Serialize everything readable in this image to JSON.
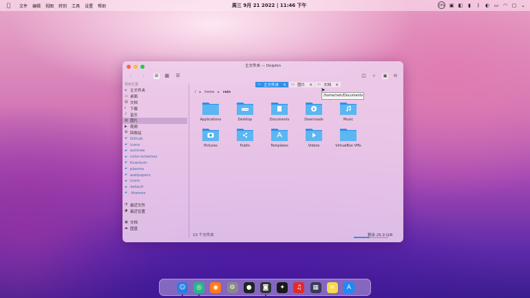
{
  "menubar": {
    "menus": [
      "文件",
      "编辑",
      "视图",
      "转到",
      "工具",
      "设置",
      "帮助"
    ],
    "clock": "周三 9月 21 2022 | 11:46 下午",
    "tray_percent": "19%",
    "tray_icons": [
      "cpu-icon",
      "monitor-icon",
      "package-icon",
      "battery-icon",
      "bluetooth-icon",
      "theme-icon",
      "battery-full-icon",
      "wifi-icon",
      "display-icon",
      "dropdown-icon"
    ]
  },
  "window": {
    "title": "主文件夹 — Dolphin",
    "colors": {
      "close": "#ff5f57",
      "minimize": "#febc2e",
      "maximize": "#28c840",
      "accent": "#2e8fe6"
    }
  },
  "sidebar": {
    "places_header": "常用位置",
    "places": [
      {
        "label": "主文件夹",
        "icon": "home-icon"
      },
      {
        "label": "桌面",
        "icon": "desktop-icon"
      },
      {
        "label": "文档",
        "icon": "document-icon"
      },
      {
        "label": "下载",
        "icon": "download-icon"
      },
      {
        "label": "音乐",
        "icon": "music-icon"
      },
      {
        "label": "图片",
        "icon": "picture-icon",
        "selected": true
      },
      {
        "label": "视频",
        "icon": "video-icon"
      },
      {
        "label": "回收站",
        "icon": "trash-icon"
      },
      {
        "label": "Github",
        "icon": "folder-icon"
      },
      {
        "label": "icons",
        "icon": "folder-icon"
      },
      {
        "label": "aurorae",
        "icon": "folder-icon"
      },
      {
        "label": "color-schemes",
        "icon": "folder-icon"
      },
      {
        "label": "Kvantum",
        "icon": "folder-icon"
      },
      {
        "label": "plasma",
        "icon": "folder-icon"
      },
      {
        "label": "wallpapers",
        "icon": "folder-icon"
      },
      {
        "label": "icons",
        "icon": "folder-icon"
      },
      {
        "label": "default",
        "icon": "folder-icon"
      },
      {
        "label": ".themes",
        "icon": "folder-icon"
      }
    ],
    "recent": [
      {
        "label": "最近文件",
        "icon": "recent-files-icon"
      },
      {
        "label": "最近位置",
        "icon": "recent-locations-icon"
      }
    ],
    "devices": [
      {
        "label": "文档",
        "icon": "drive-icon"
      },
      {
        "label": "固盘",
        "icon": "disk-icon"
      }
    ]
  },
  "tabs": [
    {
      "label": "主文件夹",
      "icon": "folder-icon",
      "active": true
    },
    {
      "label": "图片",
      "icon": "folder-icon",
      "active": false
    },
    {
      "label": "文档",
      "icon": "folder-icon",
      "active": false
    }
  ],
  "breadcrumb": {
    "root": "/",
    "parts": [
      "home",
      "rain"
    ]
  },
  "tooltip": "/home/rain/Documents",
  "files": [
    {
      "label": "Applications",
      "emblem": "none"
    },
    {
      "label": "Desktop",
      "emblem": "desktop"
    },
    {
      "label": "Documents",
      "emblem": "document"
    },
    {
      "label": "Downloads",
      "emblem": "download"
    },
    {
      "label": "Music",
      "emblem": "music"
    },
    {
      "label": "Pictures",
      "emblem": "camera"
    },
    {
      "label": "Public",
      "emblem": "share"
    },
    {
      "label": "Templates",
      "emblem": "template"
    },
    {
      "label": "Videos",
      "emblem": "play"
    },
    {
      "label": "VirtualBox VMs",
      "emblem": "none"
    }
  ],
  "status": {
    "count": "10 个文件夹",
    "free": "剩余 26.9 GiB",
    "used_fraction": 0.45
  },
  "dock": [
    {
      "name": "finder-icon",
      "color": "#2a7de1",
      "running": true
    },
    {
      "name": "browser-icon",
      "color": "#2bb38a",
      "running": true
    },
    {
      "name": "firefox-icon",
      "color": "#ff7a18",
      "running": false
    },
    {
      "name": "settings-icon",
      "color": "#8a8a8a",
      "running": false
    },
    {
      "name": "github-icon",
      "color": "#222222",
      "running": false
    },
    {
      "name": "video-capture-icon",
      "color": "#333333",
      "running": true
    },
    {
      "name": "safari-icon",
      "color": "#1a1a1a",
      "running": false
    },
    {
      "name": "music-player-icon",
      "color": "#e12a2a",
      "running": false
    },
    {
      "name": "app-grid-icon",
      "color": "#3a3a5a",
      "running": false
    },
    {
      "name": "notes-icon",
      "color": "#f7d94c",
      "running": false
    },
    {
      "name": "appstore-icon",
      "color": "#1b8bf5",
      "running": false
    }
  ]
}
